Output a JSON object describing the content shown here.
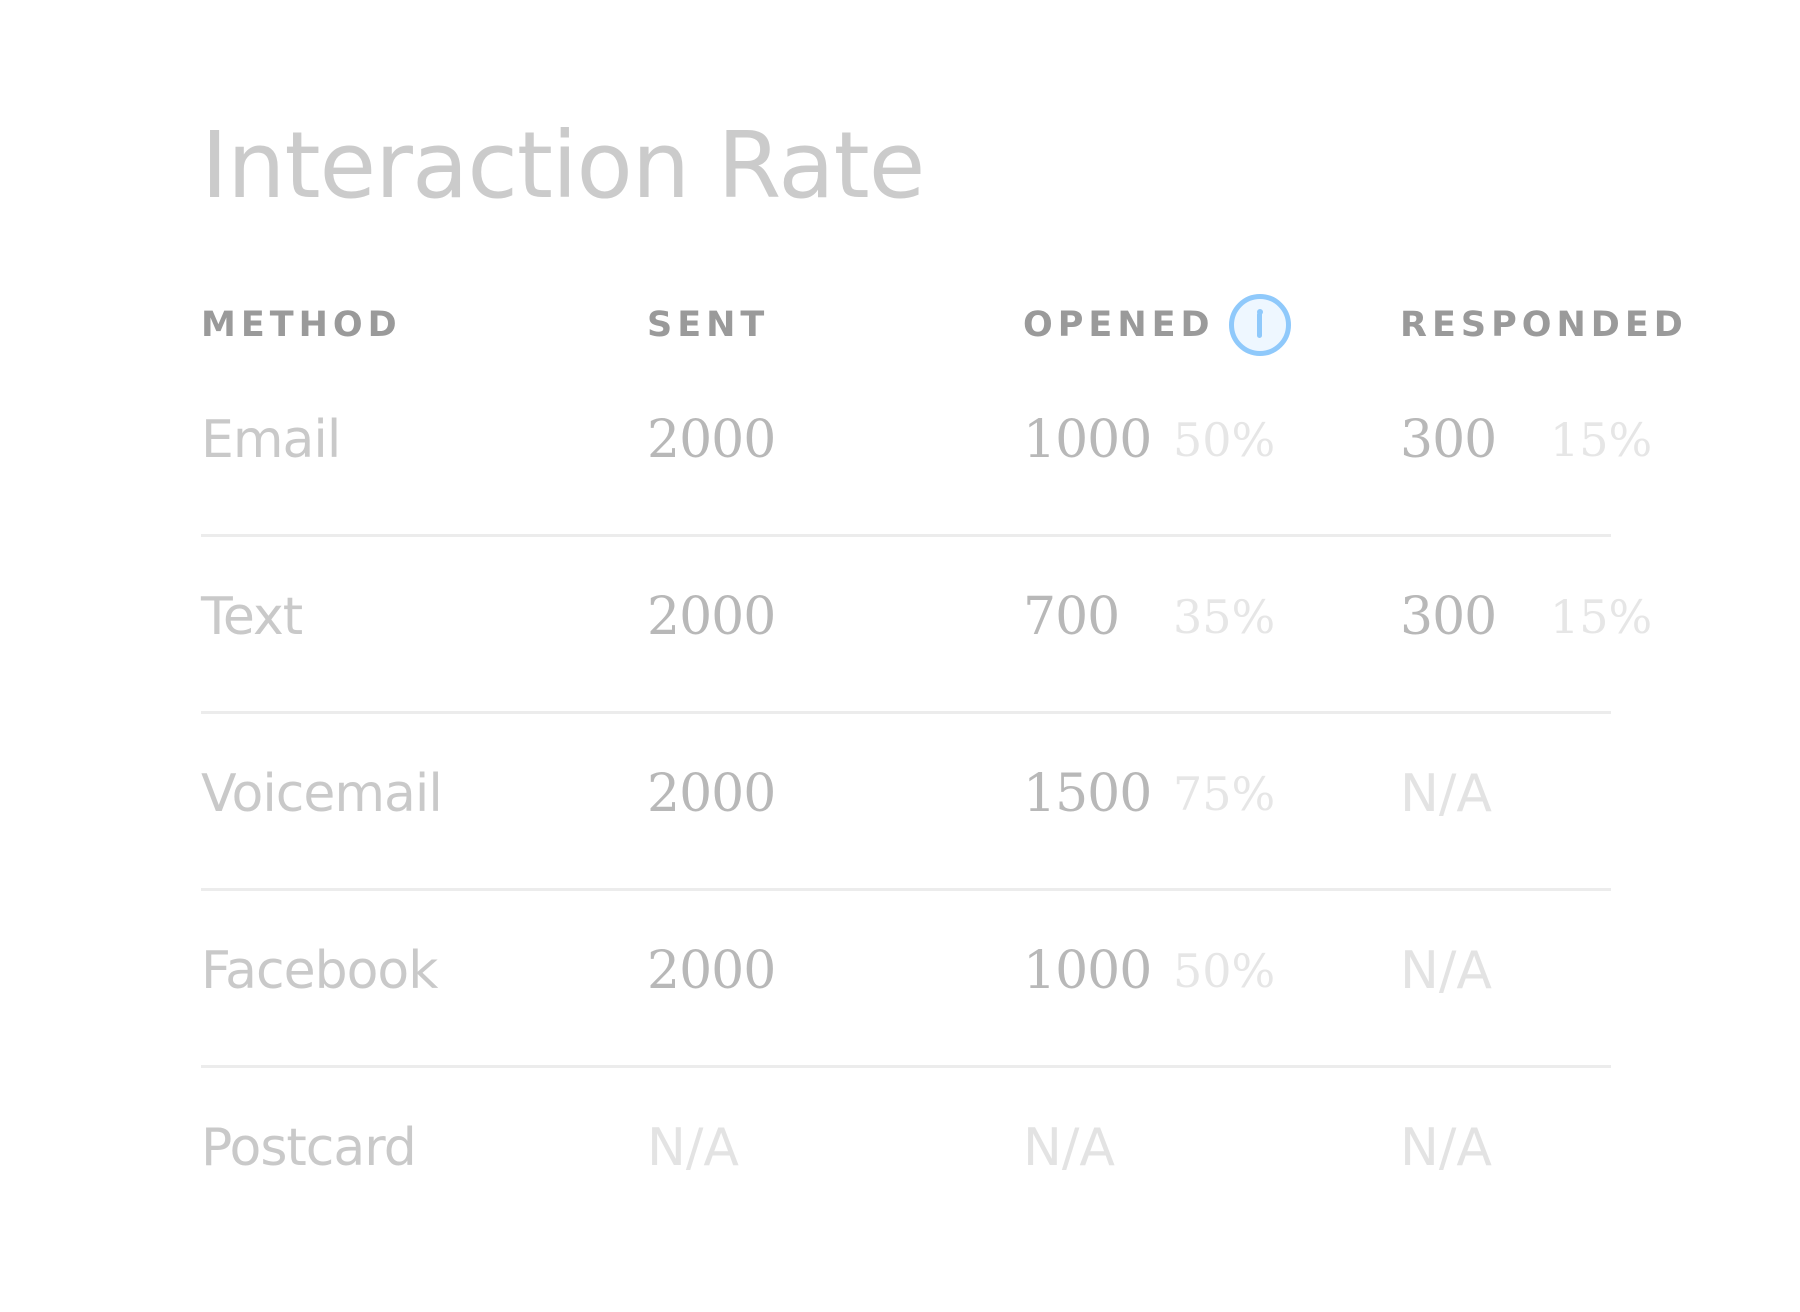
{
  "title": "Interaction Rate",
  "columns": {
    "method": "METHOD",
    "sent": "SENT",
    "opened": "OPENED",
    "responded": "RESPONDED"
  },
  "icons": {
    "opened_info": "info-icon"
  },
  "colors": {
    "accent": "#8fc9fb",
    "divider": "#ececec"
  },
  "rows": [
    {
      "method": "Email",
      "sent": "2000",
      "opened": "1000",
      "opened_pct": "50%",
      "responded": "300",
      "responded_pct": "15%"
    },
    {
      "method": "Text",
      "sent": "2000",
      "opened": "700",
      "opened_pct": "35%",
      "responded": "300",
      "responded_pct": "15%"
    },
    {
      "method": "Voicemail",
      "sent": "2000",
      "opened": "1500",
      "opened_pct": "75%",
      "responded": "N/A",
      "responded_pct": ""
    },
    {
      "method": "Facebook",
      "sent": "2000",
      "opened": "1000",
      "opened_pct": "50%",
      "responded": "N/A",
      "responded_pct": ""
    },
    {
      "method": "Postcard",
      "sent": "N/A",
      "opened": "N/A",
      "opened_pct": "",
      "responded": "N/A",
      "responded_pct": ""
    }
  ]
}
